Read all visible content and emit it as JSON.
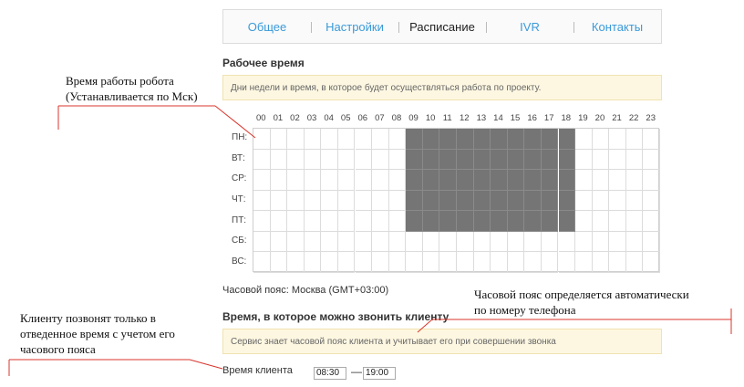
{
  "tabs": [
    {
      "label": "Общее",
      "active": false
    },
    {
      "label": "Настройки",
      "active": false
    },
    {
      "label": "Расписание",
      "active": true
    },
    {
      "label": "IVR",
      "active": false
    },
    {
      "label": "Контакты",
      "active": false
    }
  ],
  "work_time": {
    "title": "Рабочее время",
    "hint": "Дни недели и время, в которое будет осуществляться работа по проекту."
  },
  "schedule": {
    "hours": [
      "00",
      "01",
      "02",
      "03",
      "04",
      "05",
      "06",
      "07",
      "08",
      "09",
      "10",
      "11",
      "12",
      "13",
      "14",
      "15",
      "16",
      "17",
      "18",
      "19",
      "20",
      "21",
      "22",
      "23"
    ],
    "days": [
      "ПН:",
      "ВТ:",
      "СР:",
      "ЧТ:",
      "ПТ:",
      "СБ:",
      "ВС:"
    ],
    "active_weekdays": [
      0,
      1,
      2,
      3,
      4
    ],
    "active_hours": [
      9,
      10,
      11,
      12,
      13,
      14,
      15,
      16,
      17,
      18
    ]
  },
  "timezone_text": "Часовой пояс: Москва (GMT+03:00)",
  "client_time": {
    "title": "Время, в которое можно звонить клиенту",
    "hint": "Сервис знает часовой пояс клиента и учитывает его при совершении звонка",
    "label": "Время клиента",
    "from": "08:30",
    "to": "19:00",
    "separator": "—"
  },
  "annotations": {
    "robot_time_line1": "Время работы робота",
    "robot_time_line2": "(Устанавливается по Мск)",
    "timezone_line1": "Часовой пояс определяется автоматически",
    "timezone_line2": "по номеру телефона",
    "client_line1": "Клиенту позвонят только в",
    "client_line2": "отведенное время с учетом его",
    "client_line3": "часового пояса"
  },
  "colors": {
    "tab_link": "#3a9ad9",
    "active_cell": "#757575",
    "hint_bg": "#fdf7e1",
    "annotation_line": "#d9352b"
  }
}
